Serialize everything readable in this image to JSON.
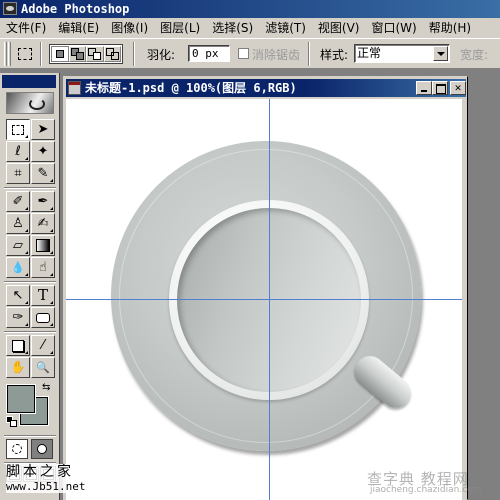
{
  "app": {
    "title": "Adobe Photoshop"
  },
  "menu": [
    "文件(F)",
    "编辑(E)",
    "图像(I)",
    "图层(L)",
    "选择(S)",
    "滤镜(T)",
    "视图(V)",
    "窗口(W)",
    "帮助(H)"
  ],
  "options": {
    "tool_icon": "rectangular-marquee-icon",
    "selection_modes": [
      "new-selection",
      "add-to-selection",
      "subtract-from-selection",
      "intersect-with-selection"
    ],
    "active_mode": "new-selection",
    "feather_label": "羽化:",
    "feather_value": "0 px",
    "antialias_label": "消除锯齿",
    "antialias_checked": false,
    "style_label": "样式:",
    "style_value": "正常",
    "width_label": "宽度:"
  },
  "toolbox": {
    "tools": [
      {
        "name": "rectangular-marquee",
        "glyph": "⬚",
        "active": true
      },
      {
        "name": "move",
        "glyph": "➤"
      },
      {
        "name": "lasso",
        "glyph": "ℓ"
      },
      {
        "name": "magic-wand",
        "glyph": "✦"
      },
      {
        "name": "crop",
        "glyph": "⌗"
      },
      {
        "name": "slice",
        "glyph": "✎"
      },
      {
        "name": "healing-brush",
        "glyph": "✐"
      },
      {
        "name": "brush",
        "glyph": "✒"
      },
      {
        "name": "clone-stamp",
        "glyph": "♙"
      },
      {
        "name": "history-brush",
        "glyph": "✍"
      },
      {
        "name": "eraser",
        "glyph": "▱"
      },
      {
        "name": "gradient",
        "glyph": "▤"
      },
      {
        "name": "blur",
        "glyph": "💧"
      },
      {
        "name": "dodge",
        "glyph": "☝"
      },
      {
        "name": "path-selection",
        "glyph": "↖"
      },
      {
        "name": "type",
        "glyph": "T"
      },
      {
        "name": "pen",
        "glyph": "✑"
      },
      {
        "name": "rectangle-shape",
        "glyph": "▭"
      },
      {
        "name": "notes",
        "glyph": "▢"
      },
      {
        "name": "eyedropper",
        "glyph": "⁄"
      },
      {
        "name": "hand",
        "glyph": "✋"
      },
      {
        "name": "zoom",
        "glyph": "🔍"
      }
    ],
    "foreground_color": "#8e9a96",
    "background_color": "#8e9a96",
    "swap_glyph": "⇆"
  },
  "document": {
    "title": "未标题-1.psd @ 100%(图层 6,RGB)",
    "close_glyph": "✕"
  },
  "watermarks": {
    "jb51_cn": "脚本之家",
    "jb51_url": "www.Jb51.net",
    "chazidian_cn": "查字典 教程网",
    "chazidian_url": "jiaocheng.chazidian.com"
  }
}
